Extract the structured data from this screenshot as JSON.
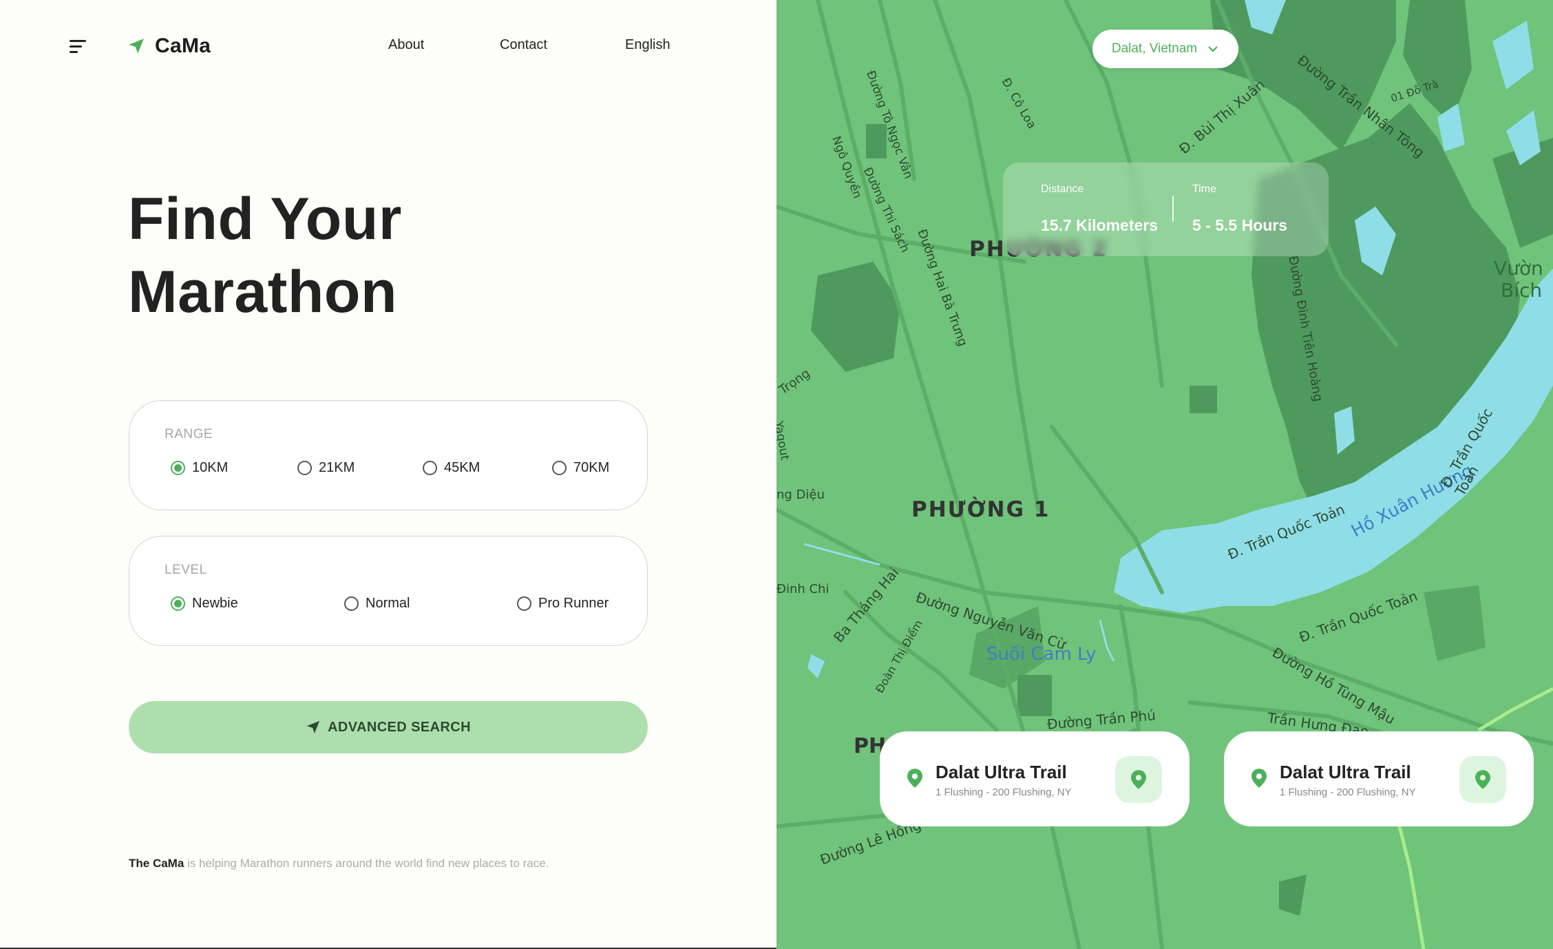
{
  "header": {
    "brand": "CaMa",
    "nav": [
      "About",
      "Contact",
      "English"
    ]
  },
  "hero": {
    "line1": "Find Your",
    "line2": "Marathon"
  },
  "range": {
    "label": "RANGE",
    "options": [
      "10KM",
      "21KM",
      "45KM",
      "70KM"
    ],
    "selected": "10KM"
  },
  "level": {
    "label": "LEVEL",
    "options": [
      "Newbie",
      "Normal",
      "Pro Runner"
    ],
    "selected": "Newbie"
  },
  "search": {
    "label": "ADVANCED SEARCH"
  },
  "footer": {
    "brand": "The CaMa",
    "text": " is helping Marathon runners around the world find new places to race."
  },
  "map": {
    "location": "Dalat, Vietnam",
    "stats": {
      "distance_label": "Distance",
      "distance_value": "15.7 Kilometers",
      "time_label": "Time",
      "time_value": "5 - 5.5 Hours"
    },
    "labels": {
      "phuong1": "PHƯỜNG 1",
      "phuong2": "PHƯỜNG 2",
      "lake": "Hồ Xuân Hương",
      "stream": "Suối Cam Ly",
      "vuon": "Vườn",
      "bich": "Bích",
      "road1": "Đường Trần Nhân Tông",
      "road2": "Đ. Bùi Thị Xuân",
      "road3": "Đường Nguyễn Văn Cừ",
      "road4": "Đường Trần Phú",
      "road5": "Đ. Trần Quốc Toản",
      "road6": "Đường Hồ Tùng Mậu",
      "road7": "Ba Tháng Hai",
      "road8": "Đường Hai Bà Trưng",
      "road9": "Đường Lê Hồng Phong",
      "road10": "Đường Đinh Tiên Hoàng",
      "road11": "Trần Hưng Đạo",
      "road12": "Đường Tô Ngọc Vân",
      "road13": "Đ. Cô Loa",
      "road14": "Ngô Quyền",
      "road15": "Đường Thi Sách",
      "road16": "Đinh Chi",
      "road17": "Yagout",
      "road18": "ng Diệu",
      "road19": "Trọng",
      "road20": "01 Đỗ Trà",
      "road21": "Đoàn Thị Điểm",
      "ph_edge": "PH"
    },
    "races": [
      {
        "title": "Dalat Ultra Trail",
        "address": "1 Flushing - 200 Flushing, NY"
      },
      {
        "title": "Dalat Ultra Trail",
        "address": "1 Flushing - 200 Flushing, NY"
      }
    ]
  },
  "colors": {
    "accent": "#4cb05a",
    "map_base": "#6fc37a",
    "map_dark": "#4e9a5e",
    "water": "#8fdde6",
    "button_bg": "#addfae"
  }
}
